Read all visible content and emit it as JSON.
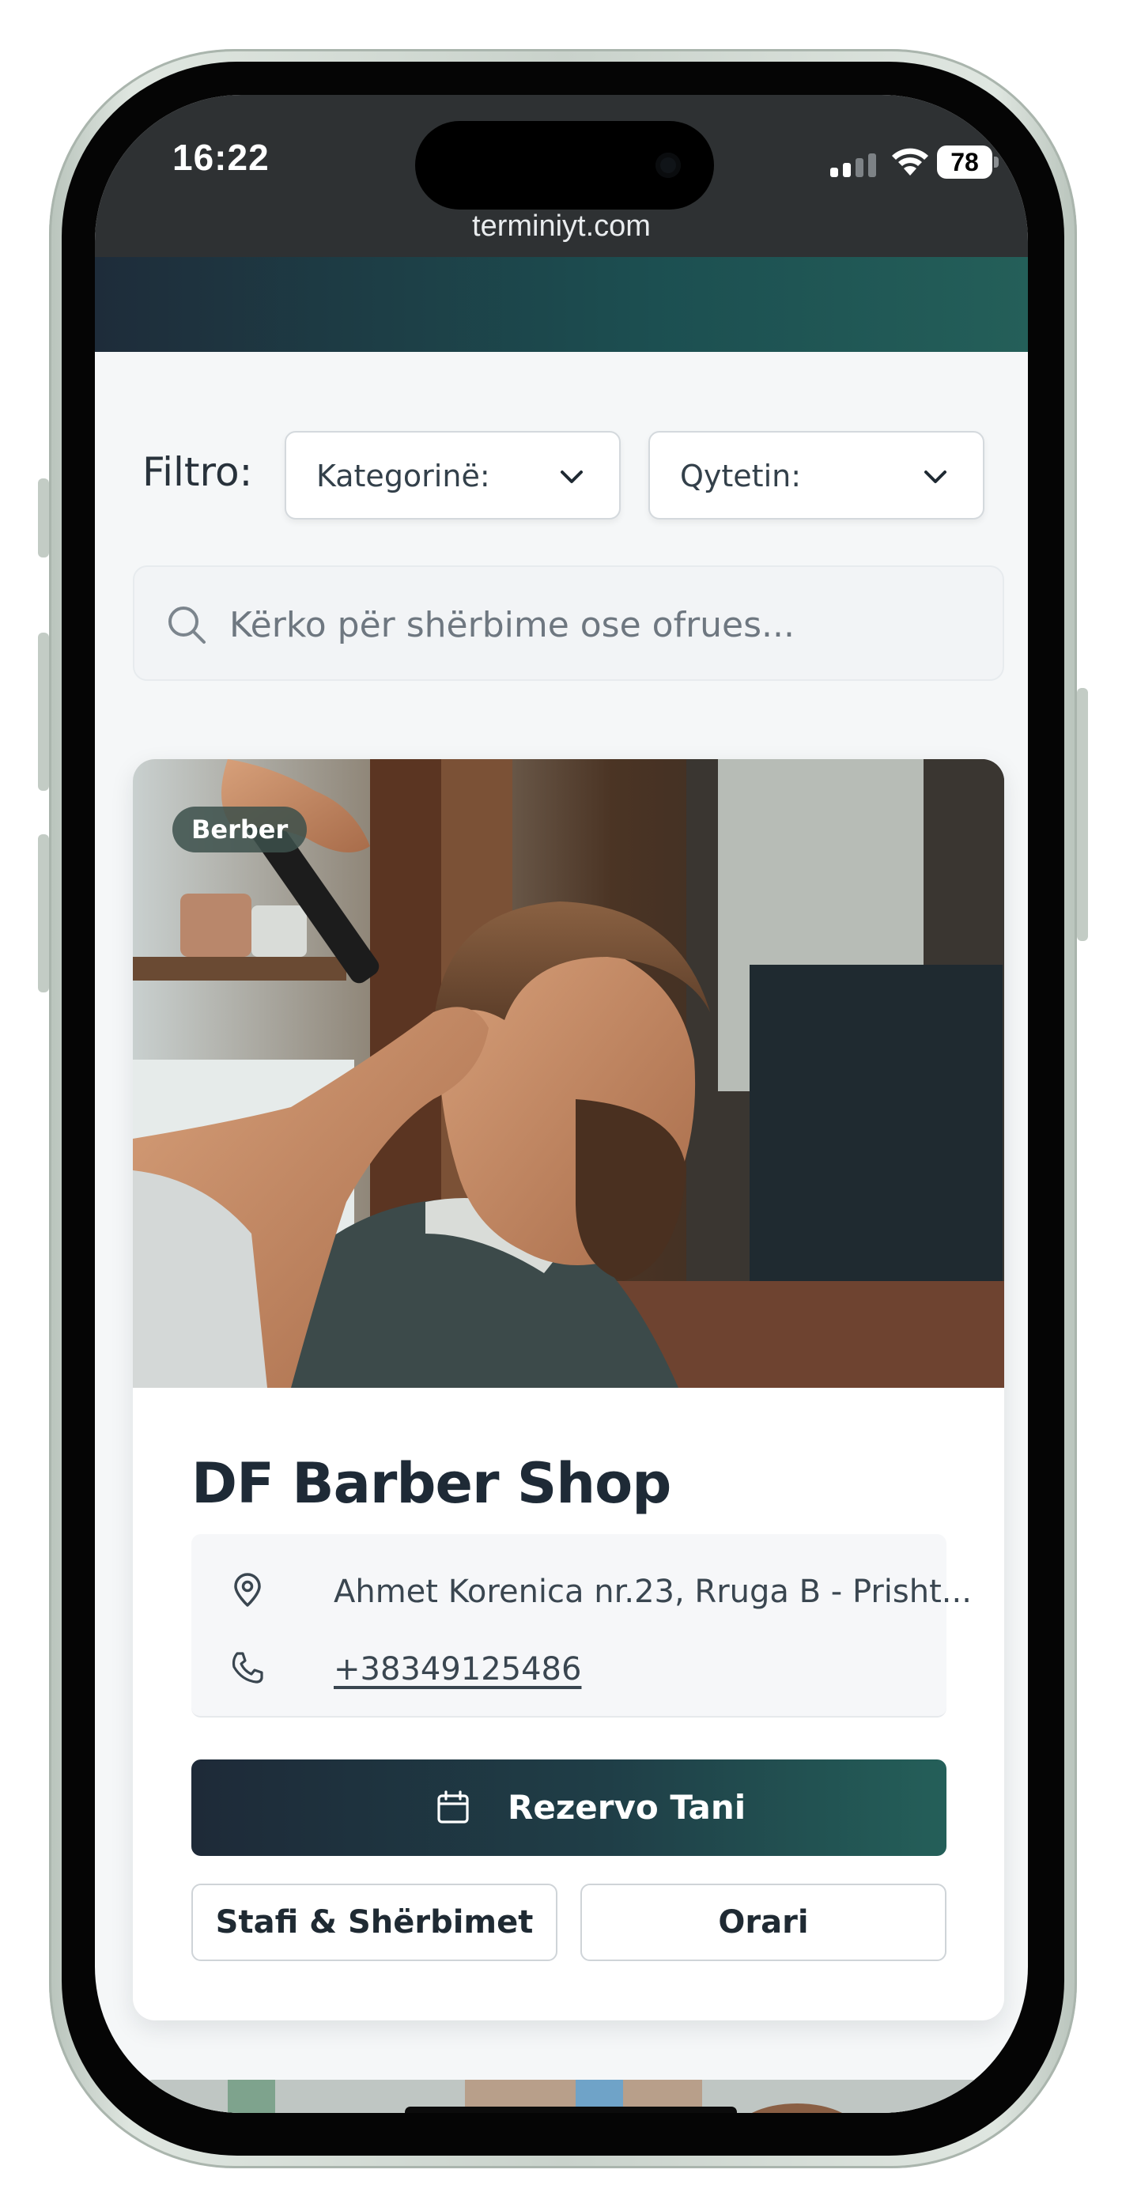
{
  "status_bar": {
    "time": "16:22",
    "battery": "78",
    "url": "terminiyt.com"
  },
  "filter": {
    "label": "Filtro:",
    "category_select": "Kategorinë:",
    "city_select": "Qytetin:"
  },
  "search": {
    "placeholder": "Kërko për shërbime ose ofrues..."
  },
  "card": {
    "badge": "Berber",
    "title": "DF Barber Shop",
    "address": "Ahmet Korenica nr.23, Rruga B - Prisht...",
    "phone": "+38349125486",
    "book_button": "Rezervo Tani",
    "staff_button": "Stafi & Shërbimet",
    "hours_button": "Orari"
  },
  "colors": {
    "brand_dark": "#1e2a38",
    "brand_teal": "#245f59"
  }
}
